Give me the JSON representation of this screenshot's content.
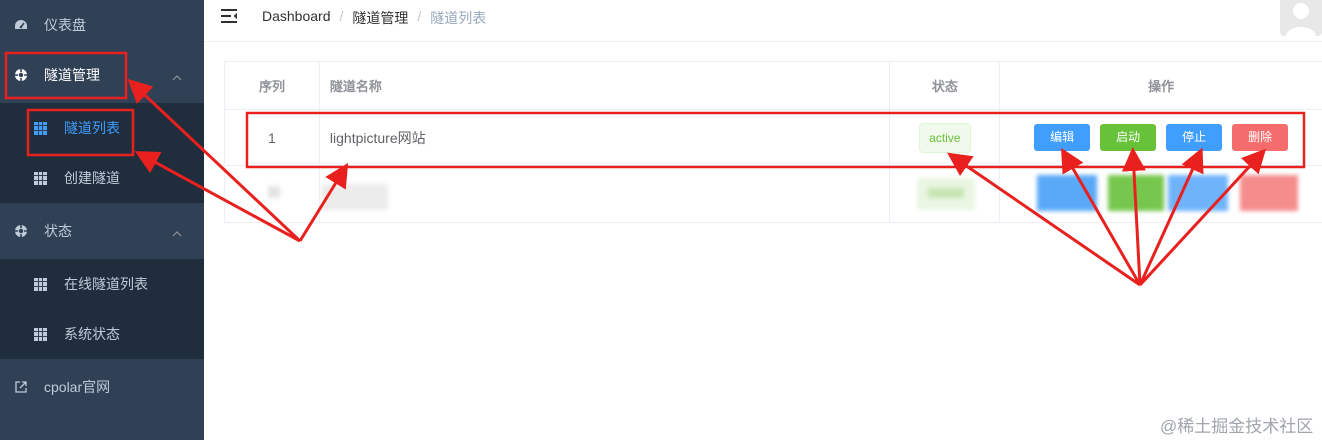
{
  "sidebar": {
    "dashboard": {
      "label": "仪表盘",
      "icon": "dashboard-icon"
    },
    "tunnel_mgmt": {
      "label": "隧道管理",
      "icon": "lifebuoy-icon"
    },
    "tunnel_list": {
      "label": "隧道列表",
      "icon": "grid-icon"
    },
    "create_tunnel": {
      "label": "创建隧道",
      "icon": "grid-icon"
    },
    "status": {
      "label": "状态",
      "icon": "lifebuoy-icon"
    },
    "online_tunnels": {
      "label": "在线隧道列表",
      "icon": "grid-icon"
    },
    "system_status": {
      "label": "系统状态",
      "icon": "grid-icon"
    },
    "cpolar_site": {
      "label": "cpolar官网",
      "icon": "external-link-icon"
    }
  },
  "breadcrumb": {
    "items": [
      "Dashboard",
      "隧道管理",
      "隧道列表"
    ],
    "separator": "/"
  },
  "table": {
    "headers": {
      "index": "序列",
      "name": "隧道名称",
      "status": "状态",
      "actions": "操作"
    },
    "rows": [
      {
        "index": "1",
        "name": "lightpicture网站",
        "status": "active"
      }
    ],
    "actions": {
      "edit": "编辑",
      "start": "启动",
      "stop": "停止",
      "delete": "删除"
    }
  },
  "watermark": "@稀土掘金技术社区",
  "colors": {
    "sidebar_bg": "#304156",
    "submenu_bg": "#1f2d3d",
    "accent": "#409eff",
    "success": "#67c23a",
    "danger": "#f56c6c",
    "annotation": "#e8211f"
  }
}
